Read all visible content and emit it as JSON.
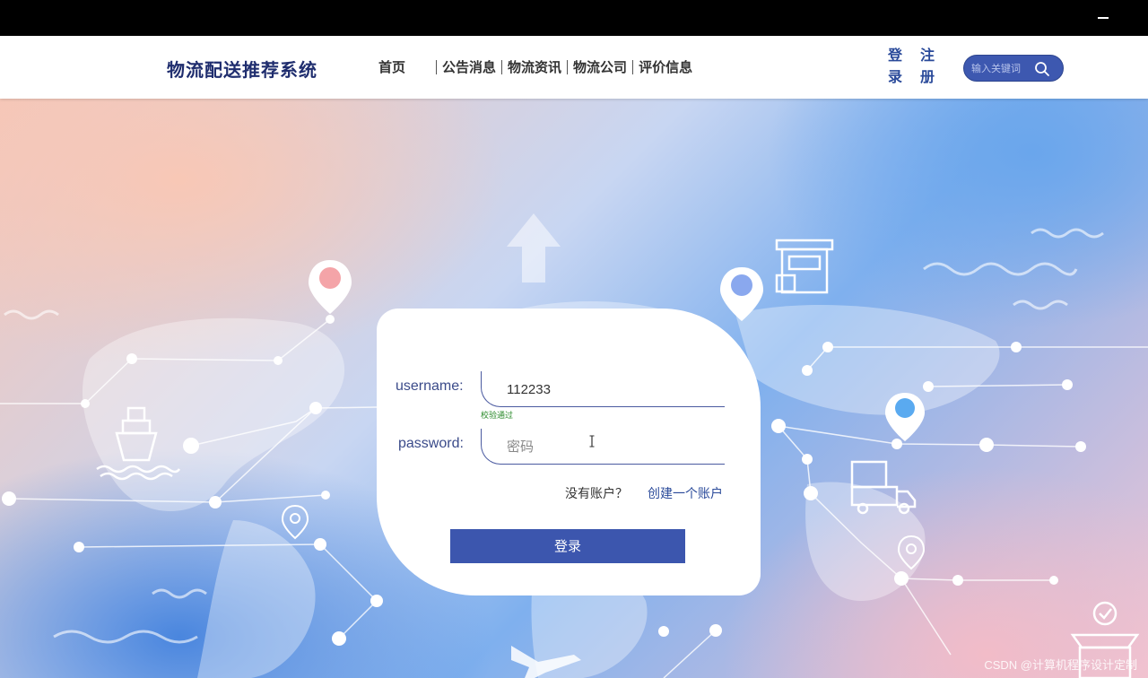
{
  "header": {
    "brand": "物流配送推荐系统",
    "nav": [
      "首页",
      "公告消息",
      "物流资讯",
      "物流公司",
      "评价信息"
    ],
    "login": [
      "登",
      "录"
    ],
    "register": [
      "注",
      "册"
    ],
    "search_placeholder": "输入关键词"
  },
  "form": {
    "username_label": "username:",
    "username_value": "112233",
    "verify_text": "校验通过",
    "password_label": "password:",
    "password_placeholder": "密码",
    "no_account": "没有账户？",
    "create_account": "创建一个账户",
    "login_button": "登录"
  },
  "watermark": "CSDN @计算机程序设计定制",
  "colors": {
    "brand": "#1f2d6e",
    "accent": "#3c56ae",
    "verify": "#2a8a2a"
  }
}
